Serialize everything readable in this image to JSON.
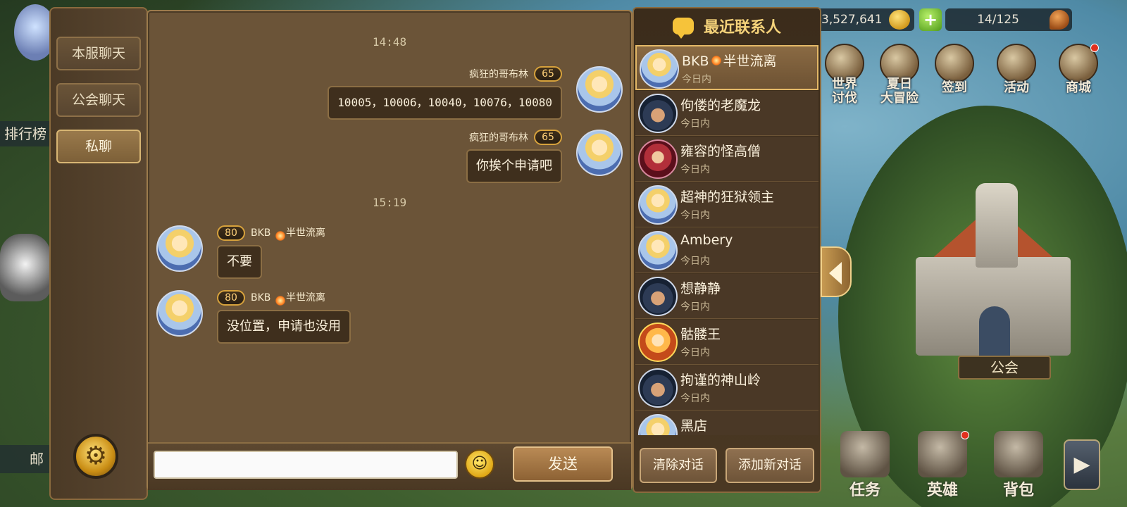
{
  "hud": {
    "gold": "3,527,641",
    "plus": "+",
    "food": "14/125",
    "top_icons": [
      "世界\n讨伐",
      "夏日\n大冒险",
      "签到",
      "活动",
      "商城"
    ],
    "left_labels": [
      "排行榜",
      "邮"
    ],
    "guild_sign": "公会",
    "bottom_nav": [
      "任务",
      "英雄",
      "背包"
    ],
    "nav_arrow": "▶"
  },
  "chat": {
    "tabs": [
      "本服聊天",
      "公会聊天",
      "私聊"
    ],
    "active_tab": "私聊",
    "settings_icon": "gear-icon",
    "messages": [
      {
        "kind": "time",
        "text": "14:48"
      },
      {
        "kind": "msg",
        "side": "right",
        "sender": "疯狂的哥布林",
        "level": "65",
        "text": "10005，10006，10040，10076，10080"
      },
      {
        "kind": "msg",
        "side": "right",
        "sender": "疯狂的哥布林",
        "level": "65",
        "text": "你挨个申请吧"
      },
      {
        "kind": "time",
        "text": "15:19"
      },
      {
        "kind": "msg",
        "side": "left",
        "sender_a": "BKB",
        "sender_b": "半世流离",
        "level": "80",
        "text": "不要"
      },
      {
        "kind": "msg",
        "side": "left",
        "sender_a": "BKB",
        "sender_b": "半世流离",
        "level": "80",
        "text": "没位置，申请也没用"
      }
    ],
    "input": {
      "value": "",
      "placeholder": ""
    },
    "emoji_icon": "☺",
    "send_label": "发送"
  },
  "contacts": {
    "title": "最近联系人",
    "list": [
      {
        "name_a": "BKB",
        "name_b": "半世流离",
        "sub": "今日内",
        "avatar": "girl",
        "selected": true
      },
      {
        "name_a": "佝偻的老魔龙",
        "name_b": "",
        "sub": "今日内",
        "avatar": "pirate",
        "selected": false
      },
      {
        "name_a": "雍容的怪高僧",
        "name_b": "",
        "sub": "今日内",
        "avatar": "monk",
        "selected": false
      },
      {
        "name_a": "超神的狂狱领主",
        "name_b": "",
        "sub": "今日内",
        "avatar": "girl",
        "selected": false
      },
      {
        "name_a": "Ambery",
        "name_b": "",
        "sub": "今日内",
        "avatar": "girl",
        "selected": false
      },
      {
        "name_a": "想静静",
        "name_b": "",
        "sub": "今日内",
        "avatar": "pirate",
        "selected": false
      },
      {
        "name_a": "骷髅王",
        "name_b": "",
        "sub": "今日内",
        "avatar": "king",
        "selected": false
      },
      {
        "name_a": "拘谨的神山岭",
        "name_b": "",
        "sub": "今日内",
        "avatar": "pirate",
        "selected": false
      },
      {
        "name_a": "黑店",
        "name_b": "",
        "sub": "",
        "avatar": "girl",
        "selected": false
      }
    ],
    "clear_label": "清除对话",
    "add_label": "添加新对话"
  }
}
